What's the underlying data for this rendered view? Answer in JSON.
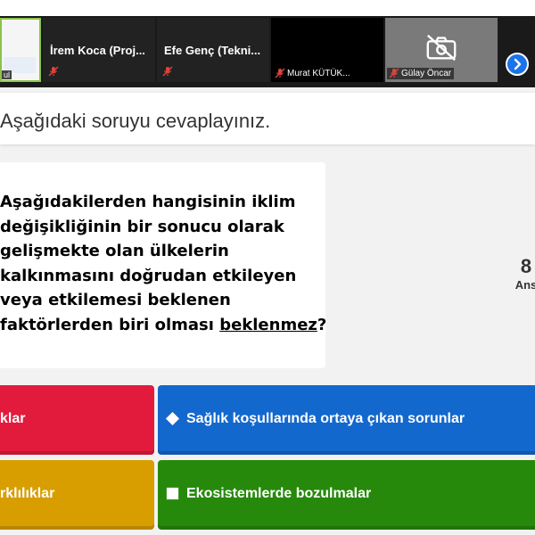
{
  "participants": [
    {
      "name": "",
      "label": "ul",
      "self_view": true
    },
    {
      "name": "İrem Koca (Proj...",
      "mic_muted": true
    },
    {
      "name": "Efe Genç (Tekni...",
      "mic_muted": true
    },
    {
      "name": "",
      "label": "Murat KÜTÜK...",
      "mic_muted": true,
      "video": "off"
    },
    {
      "name": "",
      "label": "Gülay Öncar",
      "mic_muted": true,
      "video": "camera-off-icon"
    }
  ],
  "strip_next_icon": "chevron-right-icon",
  "colors": {
    "red": "#e21b3c",
    "blue": "#1368ce",
    "yellow": "#d89e00",
    "green": "#26890c"
  },
  "question": {
    "header": "Aşağıdaki soruyu cevaplayınız.",
    "lines": [
      "Aşağıdakilerden hangisinin iklim",
      "değişikliğinin bir sonucu olarak",
      "gelişmekte olan ülkelerin",
      "kalkınmasını doğrudan etkileyen",
      "veya etkilemesi beklenen"
    ],
    "last_line_start": "faktörlerden biri olması ",
    "last_line_emphasis": "beklenmez",
    "last_line_end": "?"
  },
  "answers_counter": {
    "count": "8",
    "label": "Ans"
  },
  "answers": [
    {
      "shape": "triangle",
      "text": "klar"
    },
    {
      "shape": "diamond",
      "text": "Sağlık koşullarında ortaya çıkan sorunlar"
    },
    {
      "shape": "circle",
      "text": "rklılıklar"
    },
    {
      "shape": "square",
      "text": "Ekosistemlerde bozulmalar"
    }
  ]
}
